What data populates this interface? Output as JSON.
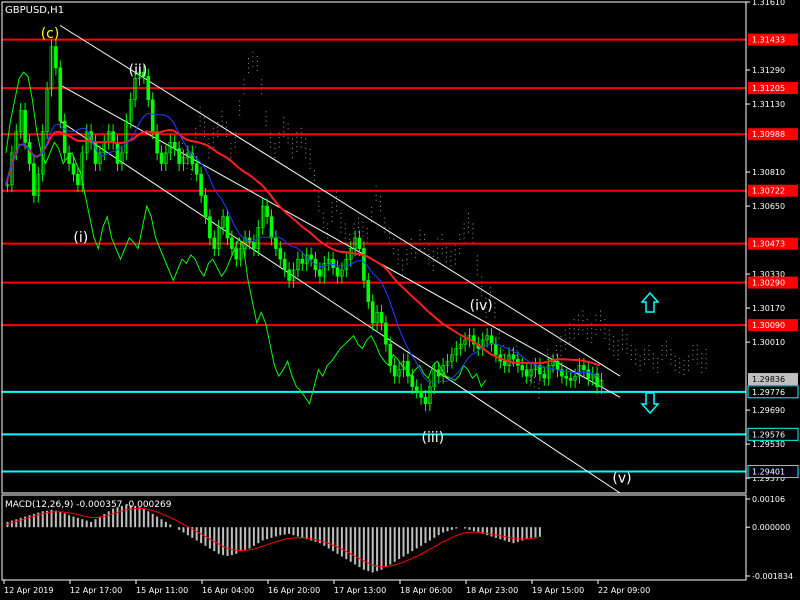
{
  "symbol": "GBPUSD,H1",
  "colors": {
    "background": "#000000",
    "frame": "#ffffff",
    "candle": "#00ff00",
    "level_red": "#ff0000",
    "level_cyan": "#00ffff",
    "price_tag_bg": "#ff0000",
    "current_tag_bg": "#c0c0c0",
    "ma_red": "#ff2020",
    "ma_blue": "#2040ff",
    "cloud": "#e0e0e0",
    "histogram": "#c0c0c0",
    "signal": "#ff0000"
  },
  "price_axis": {
    "ticks": [
      {
        "value": 1.3161,
        "label": "1.31610"
      },
      {
        "value": 1.3129,
        "label": "1.31290"
      },
      {
        "value": 1.3113,
        "label": "1.31130"
      },
      {
        "value": 1.3081,
        "label": "1.30810"
      },
      {
        "value": 1.3065,
        "label": "1.30650"
      },
      {
        "value": 1.3033,
        "label": "1.30330"
      },
      {
        "value": 1.3017,
        "label": "1.30170"
      },
      {
        "value": 1.3001,
        "label": "1.30010"
      },
      {
        "value": 1.2969,
        "label": "1.29690"
      },
      {
        "value": 1.2953,
        "label": "1.29530"
      },
      {
        "value": 1.2937,
        "label": "1.29370"
      }
    ],
    "min": 1.293,
    "max": 1.3161
  },
  "red_levels": [
    {
      "value": 1.31433,
      "label": "1.31433"
    },
    {
      "value": 1.31205,
      "label": "1.31205"
    },
    {
      "value": 1.30988,
      "label": "1.30988"
    },
    {
      "value": 1.30722,
      "label": "1.30722"
    },
    {
      "value": 1.30473,
      "label": "1.30473"
    },
    {
      "value": 1.3029,
      "label": "1.30290"
    },
    {
      "value": 1.3009,
      "label": "1.30090"
    }
  ],
  "cyan_levels": [
    {
      "value": 1.29776,
      "label": "1.29776"
    },
    {
      "value": 1.29576,
      "label": "1.29576"
    },
    {
      "value": 1.29401,
      "label": "1.29401"
    }
  ],
  "current_price": {
    "value": 1.29836,
    "label": "1.29836"
  },
  "wave_labels": [
    {
      "text": "(c)",
      "x_index": 10,
      "price": 1.3144,
      "color": "#ffff00"
    },
    {
      "text": "(ii)",
      "x_index": 30,
      "price": 1.3127,
      "color": "#ffffff"
    },
    {
      "text": "(i)",
      "x_index": 17,
      "price": 1.3048,
      "color": "#ffffff"
    },
    {
      "text": "(iv)",
      "x_index": 108,
      "price": 1.3016,
      "color": "#ffffff"
    },
    {
      "text": "(iii)",
      "x_index": 97,
      "price": 1.2954,
      "color": "#ffffff"
    },
    {
      "text": "(v)",
      "x_index": 140,
      "price": 1.2935,
      "color": "#ffffff"
    }
  ],
  "time_axis": {
    "labels": [
      {
        "text": "12 Apr 2019",
        "x_index": 0
      },
      {
        "text": "12 Apr 17:00",
        "x_index": 15
      },
      {
        "text": "15 Apr 11:00",
        "x_index": 30
      },
      {
        "text": "16 Apr 04:00",
        "x_index": 45
      },
      {
        "text": "16 Apr 20:00",
        "x_index": 60
      },
      {
        "text": "17 Apr 13:00",
        "x_index": 75
      },
      {
        "text": "18 Apr 06:00",
        "x_index": 90
      },
      {
        "text": "18 Apr 23:00",
        "x_index": 105
      },
      {
        "text": "19 Apr 15:00",
        "x_index": 120
      },
      {
        "text": "22 Apr 09:00",
        "x_index": 135
      }
    ]
  },
  "macd": {
    "title": "MACD(12,26,9) -0.000357 -0.000269",
    "axis": [
      {
        "value": 0.00106,
        "label": "0.00106"
      },
      {
        "value": 0.0,
        "label": "0.000000"
      },
      {
        "value": -0.001834,
        "label": "-0.001834"
      }
    ],
    "min": -0.001834,
    "max": 0.00106,
    "histogram": [
      0.0002,
      0.00025,
      0.0003,
      0.00035,
      0.0004,
      0.00045,
      0.0005,
      0.00055,
      0.0006,
      0.00062,
      0.00065,
      0.00062,
      0.00058,
      0.00052,
      0.00045,
      0.0004,
      0.00035,
      0.0003,
      0.00025,
      0.0002,
      0.0003,
      0.0004,
      0.0005,
      0.0006,
      0.0007,
      0.00075,
      0.0008,
      0.00085,
      0.00082,
      0.00078,
      0.00075,
      0.0007,
      0.0006,
      0.0005,
      0.0004,
      0.0003,
      0.0002,
      0.0001,
      0.0,
      -0.0001,
      -0.0002,
      -0.0003,
      -0.0004,
      -0.0005,
      -0.0006,
      -0.0007,
      -0.0008,
      -0.0009,
      -0.001,
      -0.00105,
      -0.00108,
      -0.00105,
      -0.001,
      -0.0009,
      -0.00085,
      -0.0008,
      -0.0007,
      -0.0006,
      -0.0005,
      -0.00045,
      -0.0004,
      -0.00035,
      -0.0003,
      -0.00028,
      -0.00025,
      -0.0003,
      -0.00035,
      -0.0004,
      -0.00045,
      -0.0005,
      -0.00055,
      -0.0006,
      -0.0007,
      -0.0008,
      -0.0009,
      -0.001,
      -0.0011,
      -0.0012,
      -0.0013,
      -0.0014,
      -0.0015,
      -0.0016,
      -0.00165,
      -0.0017,
      -0.00165,
      -0.0016,
      -0.0015,
      -0.0014,
      -0.0013,
      -0.0012,
      -0.0011,
      -0.001,
      -0.0009,
      -0.0008,
      -0.0007,
      -0.0006,
      -0.0005,
      -0.0004,
      -0.0003,
      -0.0002,
      -0.00015,
      -0.0001,
      -5e-05,
      0.0,
      -5e-05,
      -0.0001,
      -0.00015,
      -0.0002,
      -0.00025,
      -0.0003,
      -0.00035,
      -0.0004,
      -0.00045,
      -0.0005,
      -0.00055,
      -0.0006,
      -0.00055,
      -0.0005,
      -0.00045,
      -0.0004,
      -0.00038,
      -0.00036
    ],
    "signal": [
      0.0001,
      0.00015,
      0.0002,
      0.00025,
      0.0003,
      0.00035,
      0.0004,
      0.00045,
      0.0005,
      0.00053,
      0.00056,
      0.00058,
      0.00058,
      0.00057,
      0.00055,
      0.00052,
      0.00049,
      0.00045,
      0.00041,
      0.00037,
      0.00036,
      0.00037,
      0.0004,
      0.00044,
      0.00049,
      0.00054,
      0.00059,
      0.00064,
      0.00067,
      0.00069,
      0.0007,
      0.0007,
      0.00068,
      0.00064,
      0.00059,
      0.00053,
      0.00046,
      0.00039,
      0.00031,
      0.00023,
      0.00014,
      5e-05,
      -4e-05,
      -0.00013,
      -0.00022,
      -0.00032,
      -0.00041,
      -0.00051,
      -0.0006,
      -0.00069,
      -0.00077,
      -0.00082,
      -0.00086,
      -0.00087,
      -0.00087,
      -0.00086,
      -0.00083,
      -0.00079,
      -0.00073,
      -0.00068,
      -0.00062,
      -0.00057,
      -0.00052,
      -0.00047,
      -0.00043,
      -0.00041,
      -0.0004,
      -0.0004,
      -0.00041,
      -0.00043,
      -0.00046,
      -0.00049,
      -0.00053,
      -0.00059,
      -0.00065,
      -0.00072,
      -0.0008,
      -0.00088,
      -0.00097,
      -0.00106,
      -0.00115,
      -0.00124,
      -0.00132,
      -0.0014,
      -0.00145,
      -0.00148,
      -0.00148,
      -0.00147,
      -0.00143,
      -0.00139,
      -0.00133,
      -0.00127,
      -0.0012,
      -0.00112,
      -0.00104,
      -0.00095,
      -0.00086,
      -0.00077,
      -0.00068,
      -0.00058,
      -0.0005,
      -0.00042,
      -0.00034,
      -0.00027,
      -0.00022,
      -0.0002,
      -0.00019,
      -0.00019,
      -0.0002,
      -0.00022,
      -0.00025,
      -0.00028,
      -0.00031,
      -0.00034,
      -0.00038,
      -0.00041,
      -0.00043,
      -0.00044,
      -0.00044,
      -0.00043,
      -0.00041,
      -0.00039
    ]
  },
  "price_series": {
    "closes": [
      1.3075,
      1.309,
      1.31,
      1.311,
      1.3095,
      1.3085,
      1.307,
      1.308,
      1.31,
      1.312,
      1.314,
      1.313,
      1.3105,
      1.309,
      1.3085,
      1.308,
      1.3075,
      1.309,
      1.31,
      1.3095,
      1.3085,
      1.309,
      1.3095,
      1.31,
      1.3095,
      1.3085,
      1.309,
      1.3105,
      1.3115,
      1.3125,
      1.3128,
      1.3126,
      1.3115,
      1.31,
      1.309,
      1.3085,
      1.309,
      1.3095,
      1.3092,
      1.3085,
      1.3088,
      1.309,
      1.3085,
      1.308,
      1.307,
      1.306,
      1.305,
      1.3045,
      1.3055,
      1.306,
      1.305,
      1.3045,
      1.304,
      1.3045,
      1.305,
      1.3048,
      1.3045,
      1.3055,
      1.3065,
      1.306,
      1.305,
      1.3045,
      1.304,
      1.3035,
      1.303,
      1.3035,
      1.304,
      1.3038,
      1.3042,
      1.304,
      1.3035,
      1.3032,
      1.3038,
      1.304,
      1.3036,
      1.3032,
      1.3035,
      1.304,
      1.3045,
      1.305,
      1.3045,
      1.303,
      1.302,
      1.301,
      1.3015,
      1.301,
      1.3,
      1.299,
      1.2985,
      1.2988,
      1.2992,
      1.2985,
      1.298,
      1.2978,
      1.2975,
      1.2972,
      1.298,
      1.2988,
      1.2985,
      1.299,
      1.2992,
      1.2995,
      1.2998,
      1.3,
      1.3002,
      1.3004,
      1.3,
      1.2998,
      1.3002,
      1.3004,
      1.3,
      1.2995,
      1.2992,
      1.299,
      1.2995,
      1.2993,
      1.299,
      1.2988,
      1.2985,
      1.2988,
      1.299,
      1.2986,
      1.2984,
      1.299,
      1.2992,
      1.2988,
      1.2985,
      1.2984,
      1.2983,
      1.2985,
      1.299,
      1.2988,
      1.2984,
      1.2986,
      1.298,
      1.2983
    ]
  }
}
